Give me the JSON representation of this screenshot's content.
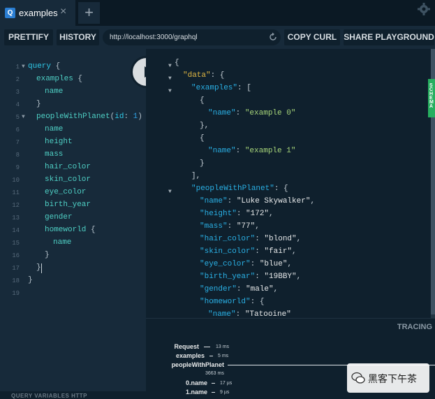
{
  "tabs": [
    {
      "badge": "Q",
      "label": "examples",
      "close": "×"
    }
  ],
  "new_tab": "+",
  "toolbar": {
    "prettify": "PRETTIFY",
    "history": "HISTORY",
    "url": "http://localhost:3000/graphql",
    "copy_curl": "COPY CURL",
    "share": "SHARE PLAYGROUND"
  },
  "line_numbers": [
    "1",
    "2",
    "3",
    "4",
    "5",
    "6",
    "7",
    "8",
    "9",
    "10",
    "11",
    "12",
    "13",
    "14",
    "15",
    "16",
    "17",
    "18",
    "19"
  ],
  "query": {
    "l1_kw": "query",
    "l1_brace": " {",
    "l2_field": "examples",
    "l2_brace": " {",
    "l3": "name",
    "l4": "}",
    "l5_field": "peopleWithPlanet",
    "l5_open": "(",
    "l5_arg": "id",
    "l5_colon": ": ",
    "l5_num": "1",
    "l5_close": ") {",
    "l6": "name",
    "l7": "height",
    "l8": "mass",
    "l9": "hair_color",
    "l10": "skin_color",
    "l11": "eye_color",
    "l12": "birth_year",
    "l13": "gender",
    "l14_field": "homeworld",
    "l14_brace": " {",
    "l15": "name",
    "l16": "}",
    "l17": "}",
    "l18": "}"
  },
  "result": {
    "data_key": "\"data\"",
    "examples_key": "\"examples\"",
    "name_key": "\"name\"",
    "example0": "\"example 0\"",
    "example1": "\"example 1\"",
    "pwp_key": "\"peopleWithPlanet\"",
    "p_name": "\"Luke Skywalker\"",
    "height_key": "\"height\"",
    "p_height": "\"172\"",
    "mass_key": "\"mass\"",
    "p_mass": "\"77\"",
    "hair_key": "\"hair_color\"",
    "p_hair": "\"blond\"",
    "skin_key": "\"skin_color\"",
    "p_skin": "\"fair\"",
    "eye_key": "\"eye_color\"",
    "p_eye": "\"blue\"",
    "birth_key": "\"birth_year\"",
    "p_birth": "\"19BBY\"",
    "gender_key": "\"gender\"",
    "p_gender": "\"male\"",
    "homeworld_key": "\"homeworld\"",
    "hw_name": "\"Tatooine\""
  },
  "tracing": {
    "title": "TRACING",
    "request": "Request",
    "request_ms": "13 ms",
    "examples": "examples",
    "examples_ms": "5 ms",
    "pwp": "peopleWithPlanet",
    "pwp_ms": "3663 ms",
    "name0": "0.name",
    "name0_us": "17 µs",
    "name1": "1.name",
    "name1_us": "9 µs"
  },
  "query_variables": "QUERY VARIABLES   HTTP",
  "watermark": "黑客下午茶",
  "colors": {
    "accent": "#27ae60",
    "badge": "#2a7ed3",
    "keyword": "#2fc8e7",
    "data_key": "#e1b743",
    "json_key": "#2ab0e5",
    "json_string": "#a8d67a"
  }
}
